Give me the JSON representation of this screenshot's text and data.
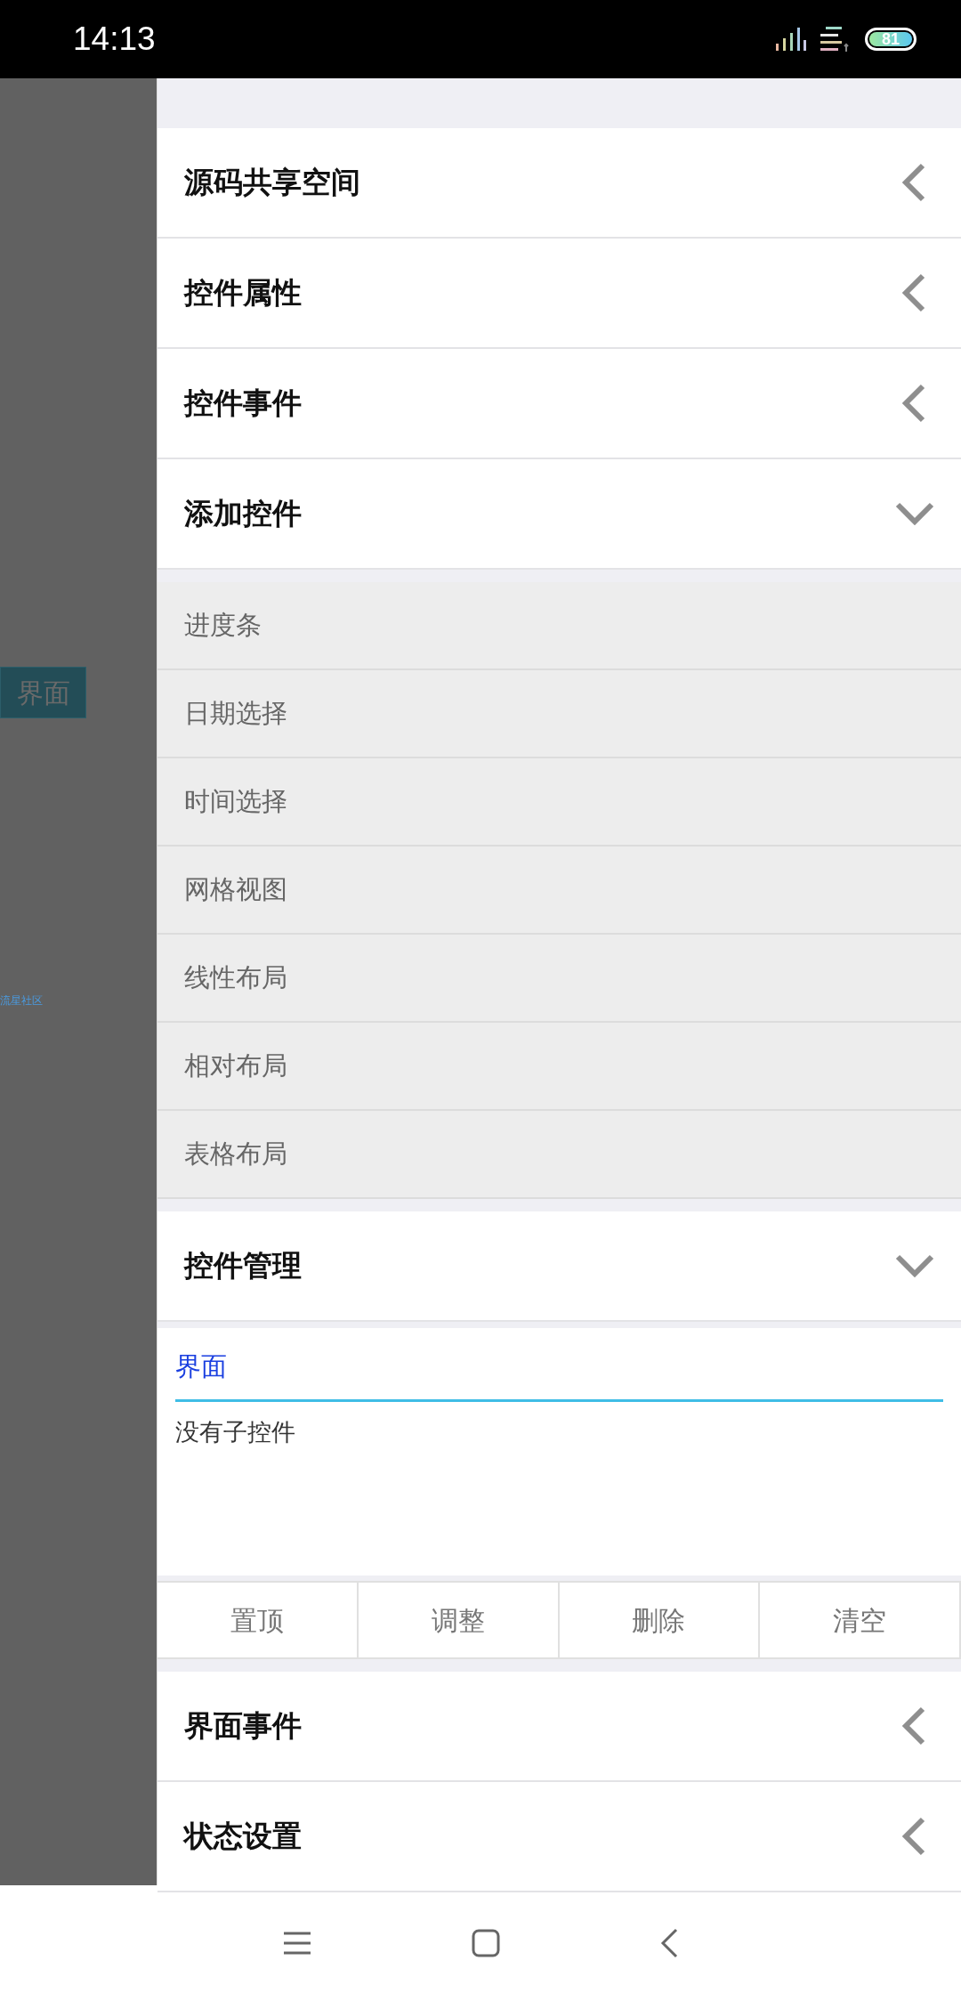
{
  "status_bar": {
    "time": "14:13",
    "battery": "81"
  },
  "canvas": {
    "view_label": "界面",
    "watermark": "流星社区"
  },
  "sections": [
    {
      "title": "源码共享空间",
      "expanded": false
    },
    {
      "title": "控件属性",
      "expanded": false
    },
    {
      "title": "控件事件",
      "expanded": false
    },
    {
      "title": "添加控件",
      "expanded": true,
      "kind": "list",
      "items": [
        "进度条",
        "日期选择",
        "时间选择",
        "网格视图",
        "线性布局",
        "相对布局",
        "表格布局"
      ]
    },
    {
      "title": "控件管理",
      "expanded": true,
      "kind": "manager",
      "tabs": [
        {
          "label": "界面",
          "selected": true
        }
      ],
      "message": "没有子控件",
      "buttons": [
        "置顶",
        "调整",
        "删除",
        "清空"
      ]
    },
    {
      "title": "界面事件",
      "expanded": false
    },
    {
      "title": "状态设置",
      "expanded": false
    }
  ]
}
